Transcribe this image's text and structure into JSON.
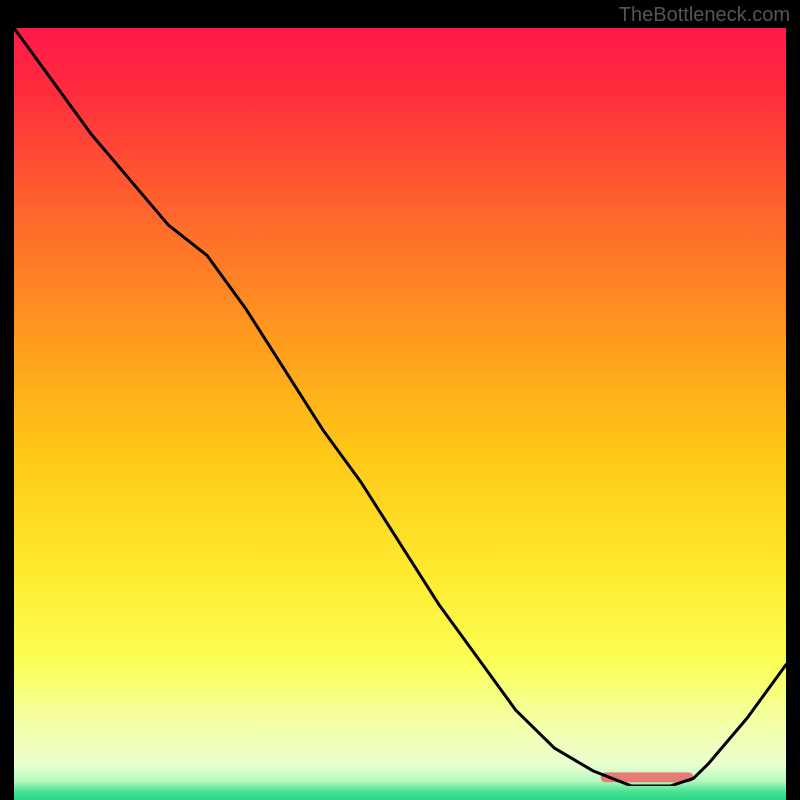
{
  "watermark": "TheBottleneck.com",
  "chart_data": {
    "type": "line",
    "title": "",
    "xlabel": "",
    "ylabel": "",
    "x": [
      0,
      5,
      10,
      15,
      20,
      25,
      30,
      35,
      40,
      45,
      50,
      55,
      60,
      65,
      70,
      75,
      80,
      82,
      85,
      88,
      90,
      95,
      100
    ],
    "values": [
      100,
      93,
      86,
      80,
      74,
      70,
      63,
      55,
      47,
      40,
      32,
      24,
      17,
      10,
      5,
      2,
      0,
      0,
      0,
      1,
      3,
      9,
      16
    ],
    "xlim": [
      0,
      100
    ],
    "ylim": [
      0,
      100
    ],
    "gradient_stops": [
      {
        "offset": 0.0,
        "color": "#ff1a4a"
      },
      {
        "offset": 0.08,
        "color": "#ff2b3d"
      },
      {
        "offset": 0.25,
        "color": "#ff6a2c"
      },
      {
        "offset": 0.4,
        "color": "#ff9a1e"
      },
      {
        "offset": 0.55,
        "color": "#ffc816"
      },
      {
        "offset": 0.7,
        "color": "#ffe92e"
      },
      {
        "offset": 0.82,
        "color": "#fbff55"
      },
      {
        "offset": 0.9,
        "color": "#f4ffa6"
      },
      {
        "offset": 0.955,
        "color": "#e9ffd0"
      },
      {
        "offset": 0.975,
        "color": "#b7f9bf"
      },
      {
        "offset": 0.99,
        "color": "#43e08f"
      },
      {
        "offset": 1.0,
        "color": "#2dd68a"
      }
    ],
    "marker": {
      "x_start": 76,
      "x_end": 88,
      "y": 1.2,
      "color": "#e87b74"
    }
  }
}
